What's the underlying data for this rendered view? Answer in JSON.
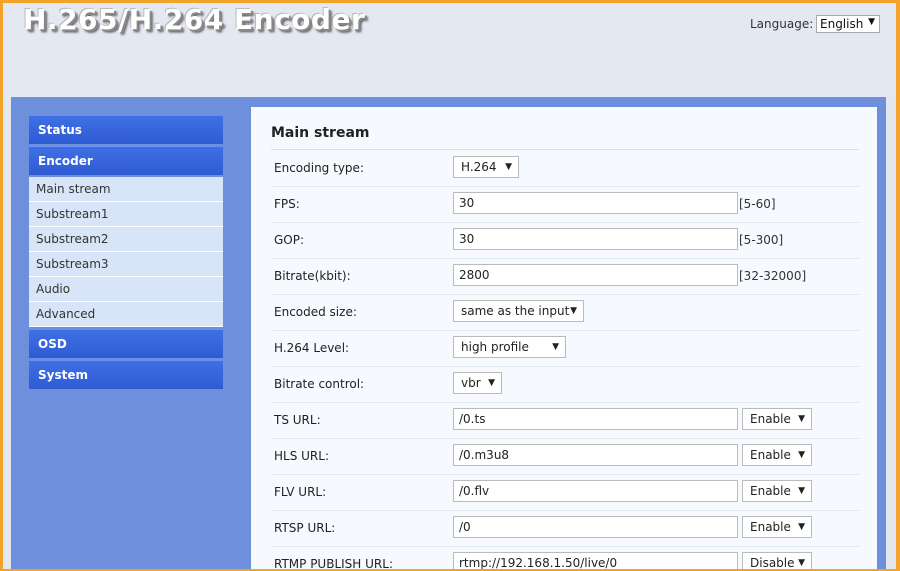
{
  "header": {
    "title": "H.265/H.264 Encoder",
    "language_label": "Language:",
    "language_value": "English"
  },
  "sidebar": {
    "status": "Status",
    "encoder": "Encoder",
    "encoder_items": [
      "Main stream",
      "Substream1",
      "Substream2",
      "Substream3",
      "Audio",
      "Advanced"
    ],
    "osd": "OSD",
    "system": "System"
  },
  "content": {
    "title": "Main stream",
    "encoding_type": {
      "label": "Encoding type:",
      "value": "H.264"
    },
    "fps": {
      "label": "FPS:",
      "value": "30",
      "range": "[5-60]"
    },
    "gop": {
      "label": "GOP:",
      "value": "30",
      "range": "[5-300]"
    },
    "bitrate": {
      "label": "Bitrate(kbit):",
      "value": "2800",
      "range": "[32-32000]"
    },
    "encoded_size": {
      "label": "Encoded size:",
      "value": "same as the input"
    },
    "level": {
      "label": "H.264 Level:",
      "value": "high profile"
    },
    "bitrate_control": {
      "label": "Bitrate control:",
      "value": "vbr"
    },
    "ts_url": {
      "label": "TS URL:",
      "value": "/0.ts",
      "state": "Enable"
    },
    "hls_url": {
      "label": "HLS URL:",
      "value": "/0.m3u8",
      "state": "Enable"
    },
    "flv_url": {
      "label": "FLV URL:",
      "value": "/0.flv",
      "state": "Enable"
    },
    "rtsp_url": {
      "label": "RTSP URL:",
      "value": "/0",
      "state": "Enable"
    },
    "rtmp_url": {
      "label": "RTMP PUBLISH URL:",
      "value": "rtmp://192.168.1.50/live/0",
      "state": "Disable"
    }
  },
  "icons": {
    "dropdown": "chevron-down-icon"
  }
}
